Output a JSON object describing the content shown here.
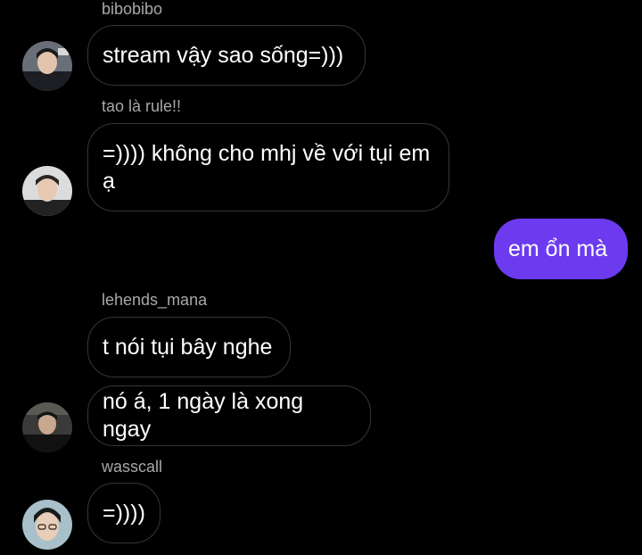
{
  "thread": {
    "messages": [
      {
        "sender": "bibobibo",
        "text": "stream vậy sao sống=)))"
      },
      {
        "sender": "tao là rule!!",
        "text": "=)))) không cho mhj về với tụi em ạ"
      },
      {
        "sender": "",
        "text": "em ổn mà",
        "outgoing": true
      },
      {
        "sender": "lehends_mana",
        "text": "t nói tụi bây nghe"
      },
      {
        "sender": "",
        "text": "nó á, 1 ngày là xong ngay"
      },
      {
        "sender": "wasscall",
        "text": "=))))"
      }
    ]
  },
  "colors": {
    "background": "#000000",
    "incoming_bubble_border": "#363636",
    "outgoing_bubble": "#6c3bef",
    "sender_name": "#a8a8a8"
  }
}
